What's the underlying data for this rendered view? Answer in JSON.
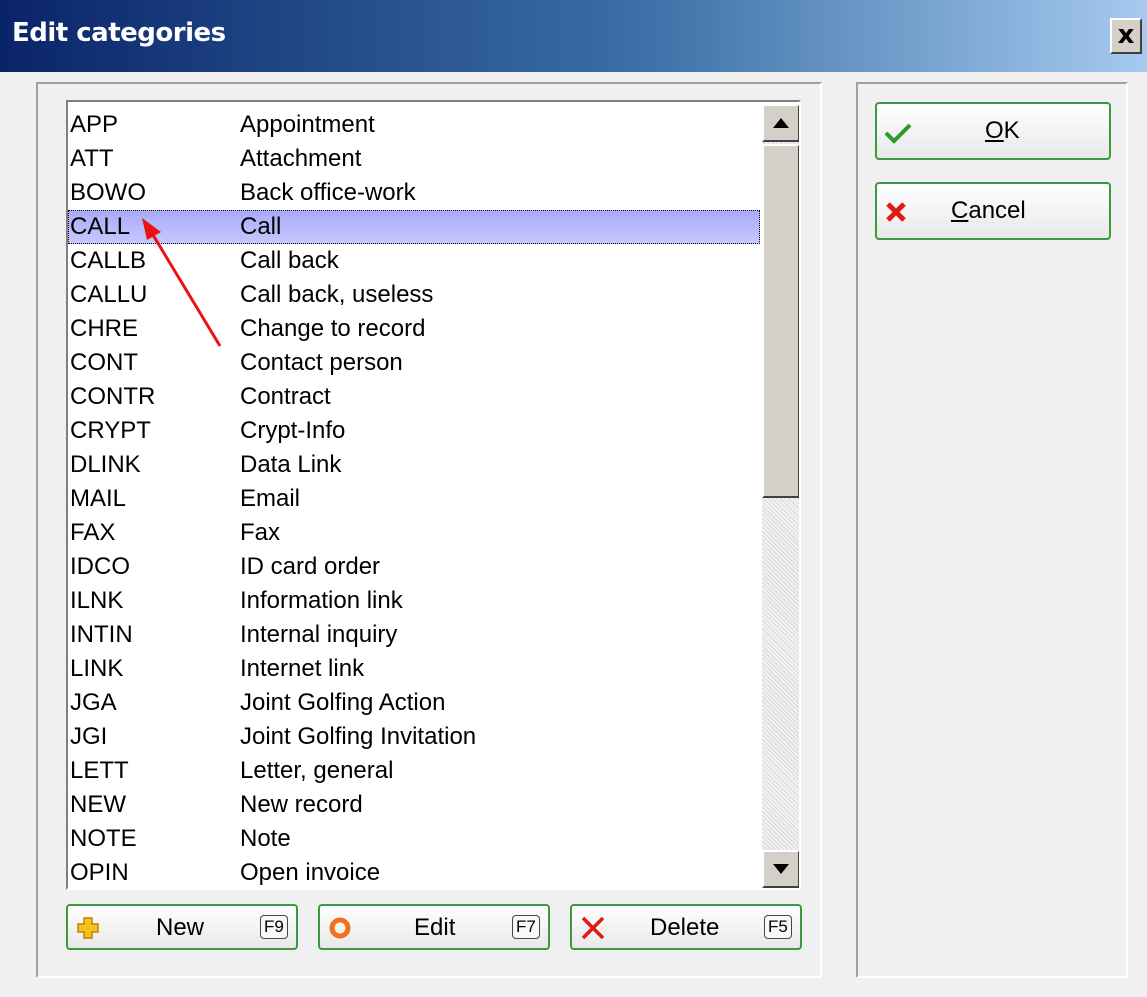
{
  "window": {
    "title": "Edit categories",
    "close_label": "x"
  },
  "categories": [
    {
      "code": "APP",
      "description": "Appointment"
    },
    {
      "code": "ATT",
      "description": "Attachment"
    },
    {
      "code": "BOWO",
      "description": "Back office-work"
    },
    {
      "code": "CALL",
      "description": "Call"
    },
    {
      "code": "CALLB",
      "description": "Call back"
    },
    {
      "code": "CALLU",
      "description": "Call back, useless"
    },
    {
      "code": "CHRE",
      "description": "Change to record"
    },
    {
      "code": "CONT",
      "description": "Contact person"
    },
    {
      "code": "CONTR",
      "description": "Contract"
    },
    {
      "code": "CRYPT",
      "description": "Crypt-Info"
    },
    {
      "code": "DLINK",
      "description": "Data Link"
    },
    {
      "code": "MAIL",
      "description": "Email"
    },
    {
      "code": "FAX",
      "description": "Fax"
    },
    {
      "code": "IDCO",
      "description": "ID card order"
    },
    {
      "code": "ILNK",
      "description": "Information link"
    },
    {
      "code": "INTIN",
      "description": "Internal inquiry"
    },
    {
      "code": "LINK",
      "description": "Internet link"
    },
    {
      "code": "JGA",
      "description": "Joint Golfing Action"
    },
    {
      "code": "JGI",
      "description": "Joint Golfing Invitation"
    },
    {
      "code": "LETT",
      "description": "Letter, general"
    },
    {
      "code": "NEW",
      "description": "New record"
    },
    {
      "code": "NOTE",
      "description": "Note"
    },
    {
      "code": "OPIN",
      "description": "Open invoice"
    }
  ],
  "selected_code": "CALL",
  "buttons": {
    "ok": {
      "label_u": "O",
      "label_rest": "K",
      "icon": "check-icon"
    },
    "cancel": {
      "label_u": "C",
      "label_rest": "ancel",
      "icon": "x-icon"
    },
    "new": {
      "label": "New",
      "key": "F9",
      "icon": "plus-icon"
    },
    "edit": {
      "label": "Edit",
      "key": "F7",
      "icon": "circle-icon"
    },
    "delete": {
      "label": "Delete",
      "key": "F5",
      "icon": "x-icon"
    }
  },
  "colors": {
    "titlebar_start": "#0a246a",
    "titlebar_end": "#a6caf0",
    "selection": "#a8aaf8",
    "button_border": "#3c9a3c",
    "annotation_arrow": "#ee1111"
  }
}
